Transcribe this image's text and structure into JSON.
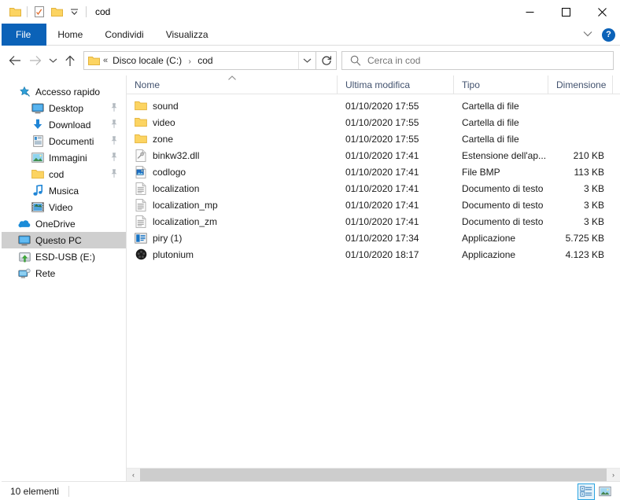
{
  "window": {
    "title": "cod",
    "quick_access": [
      "folder-icon",
      "properties-icon",
      "new-folder-icon",
      "customize-dropdown-icon"
    ],
    "controls": {
      "minimize": "—",
      "maximize": "□",
      "close": "✕"
    }
  },
  "ribbon": {
    "tabs": [
      {
        "label": "File",
        "active": true
      },
      {
        "label": "Home",
        "active": false
      },
      {
        "label": "Condividi",
        "active": false
      },
      {
        "label": "Visualizza",
        "active": false
      }
    ],
    "collapse_icon": "chevron-down-icon",
    "help_label": "?"
  },
  "address": {
    "back_icon": "←",
    "forward_icon": "→",
    "recent_icon": "⌄",
    "up_icon": "↑",
    "breadcrumb_overflow": "«",
    "breadcrumb": [
      "Disco locale (C:)",
      "cod"
    ],
    "separator": "›",
    "dropdown_icon": "⌄",
    "refresh_icon": "↻"
  },
  "search": {
    "placeholder": "Cerca in cod",
    "icon": "search-icon"
  },
  "sidebar": {
    "items": [
      {
        "label": "Accesso rapido",
        "icon": "star-pin-icon",
        "level": 0,
        "pinned": false,
        "selected": false
      },
      {
        "label": "Desktop",
        "icon": "desktop-icon",
        "level": 1,
        "pinned": true,
        "selected": false
      },
      {
        "label": "Download",
        "icon": "download-icon",
        "level": 1,
        "pinned": true,
        "selected": false
      },
      {
        "label": "Documenti",
        "icon": "documents-icon",
        "level": 1,
        "pinned": true,
        "selected": false
      },
      {
        "label": "Immagini",
        "icon": "pictures-icon",
        "level": 1,
        "pinned": true,
        "selected": false
      },
      {
        "label": "cod",
        "icon": "folder-icon",
        "level": 1,
        "pinned": true,
        "selected": false
      },
      {
        "label": "Musica",
        "icon": "music-icon",
        "level": 1,
        "pinned": false,
        "selected": false
      },
      {
        "label": "Video",
        "icon": "video-icon",
        "level": 1,
        "pinned": false,
        "selected": false
      },
      {
        "label": "OneDrive",
        "icon": "onedrive-icon",
        "level": 0,
        "pinned": false,
        "selected": false
      },
      {
        "label": "Questo PC",
        "icon": "this-pc-icon",
        "level": 0,
        "pinned": false,
        "selected": true
      },
      {
        "label": "ESD-USB (E:)",
        "icon": "usb-drive-icon",
        "level": 0,
        "pinned": false,
        "selected": false
      },
      {
        "label": "Rete",
        "icon": "network-icon",
        "level": 0,
        "pinned": false,
        "selected": false
      }
    ]
  },
  "filelist": {
    "columns": [
      {
        "label": "Nome",
        "sorted": "asc"
      },
      {
        "label": "Ultima modifica",
        "sorted": ""
      },
      {
        "label": "Tipo",
        "sorted": ""
      },
      {
        "label": "Dimensione",
        "sorted": ""
      }
    ],
    "rows": [
      {
        "name": "sound",
        "modified": "01/10/2020 17:55",
        "type": "Cartella di file",
        "size": "",
        "icon": "folder-icon"
      },
      {
        "name": "video",
        "modified": "01/10/2020 17:55",
        "type": "Cartella di file",
        "size": "",
        "icon": "folder-icon"
      },
      {
        "name": "zone",
        "modified": "01/10/2020 17:55",
        "type": "Cartella di file",
        "size": "",
        "icon": "folder-icon"
      },
      {
        "name": "binkw32.dll",
        "modified": "01/10/2020 17:41",
        "type": "Estensione dell'ap...",
        "size": "210 KB",
        "icon": "dll-file-icon"
      },
      {
        "name": "codlogo",
        "modified": "01/10/2020 17:41",
        "type": "File BMP",
        "size": "113 KB",
        "icon": "bmp-image-icon"
      },
      {
        "name": "localization",
        "modified": "01/10/2020 17:41",
        "type": "Documento di testo",
        "size": "3 KB",
        "icon": "text-file-icon"
      },
      {
        "name": "localization_mp",
        "modified": "01/10/2020 17:41",
        "type": "Documento di testo",
        "size": "3 KB",
        "icon": "text-file-icon"
      },
      {
        "name": "localization_zm",
        "modified": "01/10/2020 17:41",
        "type": "Documento di testo",
        "size": "3 KB",
        "icon": "text-file-icon"
      },
      {
        "name": "piry (1)",
        "modified": "01/10/2020 17:34",
        "type": "Applicazione",
        "size": "5.725 KB",
        "icon": "application-icon"
      },
      {
        "name": "plutonium",
        "modified": "01/10/2020 18:17",
        "type": "Applicazione",
        "size": "4.123 KB",
        "icon": "plutonium-app-icon"
      }
    ]
  },
  "scrollbar": {
    "left_arrow": "‹",
    "right_arrow": "›"
  },
  "statusbar": {
    "count_label": "10 elementi",
    "views": [
      {
        "name": "details-view",
        "active": true
      },
      {
        "name": "large-icons-view",
        "active": false
      }
    ]
  },
  "colors": {
    "accent": "#0b62b8",
    "folder": "#fcd462",
    "selection": "#cfcfcf",
    "header_text": "#42526e"
  }
}
